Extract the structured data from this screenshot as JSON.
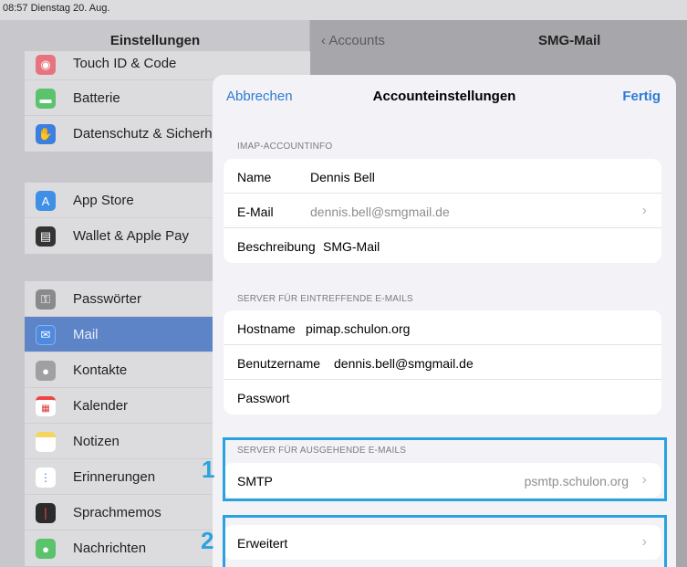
{
  "status": {
    "time": "08:57  Dienstag 20. Aug."
  },
  "sidebar": {
    "title": "Einstellungen",
    "group1": [
      {
        "label": "Touch ID & Code",
        "icon": "fingerprint-icon",
        "color": "#e7737e"
      },
      {
        "label": "Batterie",
        "icon": "battery-icon",
        "color": "#5ac36b"
      },
      {
        "label": "Datenschutz & Sicherheit",
        "icon": "hand-icon",
        "color": "#3b7fe0"
      }
    ],
    "group2": [
      {
        "label": "App Store",
        "icon": "appstore-icon",
        "color": "#3f8fe6"
      },
      {
        "label": "Wallet & Apple Pay",
        "icon": "wallet-icon",
        "color": "#333333"
      }
    ],
    "group3": [
      {
        "label": "Passwörter",
        "icon": "key-icon",
        "color": "#8a8a8e"
      },
      {
        "label": "Mail",
        "icon": "mail-icon",
        "color": "#4e8be0"
      },
      {
        "label": "Kontakte",
        "icon": "contacts-icon",
        "color": "#a0a0a4"
      },
      {
        "label": "Kalender",
        "icon": "calendar-icon",
        "color": "#ffffff"
      },
      {
        "label": "Notizen",
        "icon": "notes-icon",
        "color": "#f5d560"
      },
      {
        "label": "Erinnerungen",
        "icon": "reminders-icon",
        "color": "#ffffff"
      },
      {
        "label": "Sprachmemos",
        "icon": "voicememo-icon",
        "color": "#2b2b2b"
      },
      {
        "label": "Nachrichten",
        "icon": "messages-icon",
        "color": "#5ac36b"
      }
    ]
  },
  "detail": {
    "back": "Accounts",
    "title": "SMG-Mail"
  },
  "modal": {
    "cancel": "Abbrechen",
    "title": "Accounteinstellungen",
    "done": "Fertig",
    "imap": {
      "header": "IMAP-ACCOUNTINFO",
      "name_label": "Name",
      "name_value": "Dennis Bell",
      "email_label": "E-Mail",
      "email_value": "dennis.bell@smgmail.de",
      "desc_label": "Beschreibung",
      "desc_value": "SMG-Mail"
    },
    "incoming": {
      "header": "SERVER FÜR EINTREFFENDE E-MAILS",
      "host_label": "Hostname",
      "host_value": "pimap.schulon.org",
      "user_label": "Benutzername",
      "user_value": "dennis.bell@smgmail.de",
      "pass_label": "Passwort"
    },
    "outgoing": {
      "header": "SERVER FÜR AUSGEHENDE E-MAILS",
      "smtp_label": "SMTP",
      "smtp_value": "psmtp.schulon.org"
    },
    "advanced": {
      "label": "Erweitert"
    }
  },
  "annotations": {
    "one": "1",
    "two": "2",
    "color": "#29a3df"
  }
}
